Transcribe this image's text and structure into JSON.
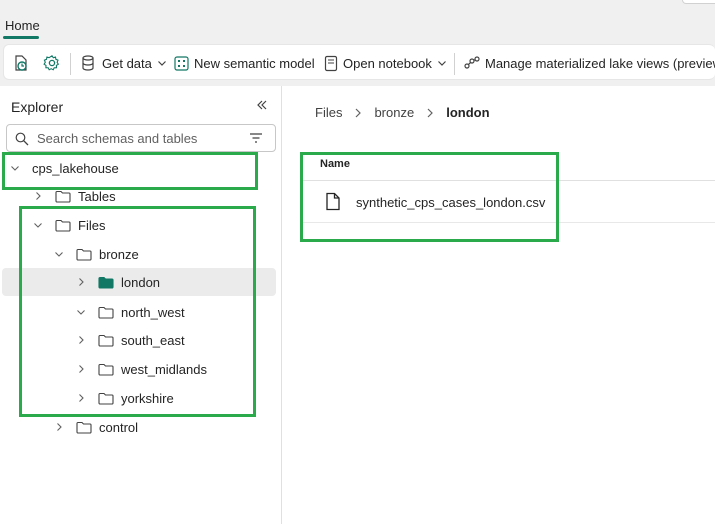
{
  "header": {
    "tab_home": "Home"
  },
  "ribbon": {
    "get_data": "Get data",
    "new_semantic_model": "New semantic model",
    "open_notebook": "Open notebook",
    "manage_mlv": "Manage materialized lake views (preview)"
  },
  "explorer": {
    "title": "Explorer",
    "search_placeholder": "Search schemas and tables",
    "tree": {
      "lakehouse": "cps_lakehouse",
      "tables": "Tables",
      "files": "Files",
      "bronze": "bronze",
      "london": "london",
      "north_west": "north_west",
      "south_east": "south_east",
      "west_midlands": "west_midlands",
      "yorkshire": "yorkshire",
      "control": "control"
    }
  },
  "main": {
    "breadcrumb": [
      "Files",
      "bronze",
      "london"
    ],
    "column_name": "Name",
    "files": [
      {
        "name": "synthetic_cps_cases_london.csv"
      }
    ]
  },
  "colors": {
    "accent": "#117865",
    "highlight": "#2aaa4a",
    "selected_row": "#ebebeb"
  }
}
